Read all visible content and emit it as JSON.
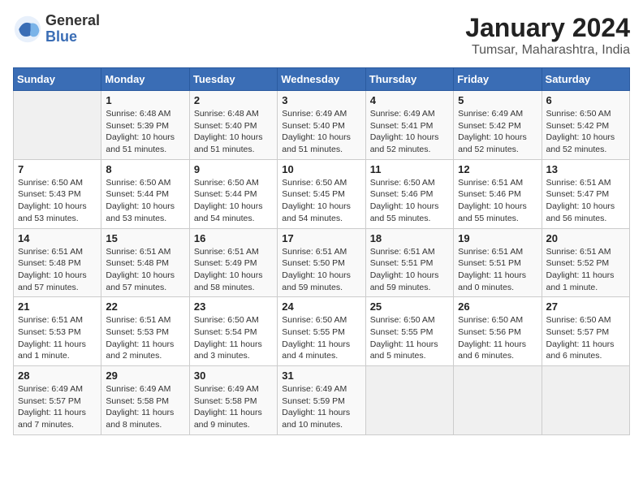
{
  "logo": {
    "general": "General",
    "blue": "Blue"
  },
  "title": {
    "month": "January 2024",
    "location": "Tumsar, Maharashtra, India"
  },
  "headers": [
    "Sunday",
    "Monday",
    "Tuesday",
    "Wednesday",
    "Thursday",
    "Friday",
    "Saturday"
  ],
  "weeks": [
    [
      {
        "day": "",
        "info": ""
      },
      {
        "day": "1",
        "info": "Sunrise: 6:48 AM\nSunset: 5:39 PM\nDaylight: 10 hours\nand 51 minutes."
      },
      {
        "day": "2",
        "info": "Sunrise: 6:48 AM\nSunset: 5:40 PM\nDaylight: 10 hours\nand 51 minutes."
      },
      {
        "day": "3",
        "info": "Sunrise: 6:49 AM\nSunset: 5:40 PM\nDaylight: 10 hours\nand 51 minutes."
      },
      {
        "day": "4",
        "info": "Sunrise: 6:49 AM\nSunset: 5:41 PM\nDaylight: 10 hours\nand 52 minutes."
      },
      {
        "day": "5",
        "info": "Sunrise: 6:49 AM\nSunset: 5:42 PM\nDaylight: 10 hours\nand 52 minutes."
      },
      {
        "day": "6",
        "info": "Sunrise: 6:50 AM\nSunset: 5:42 PM\nDaylight: 10 hours\nand 52 minutes."
      }
    ],
    [
      {
        "day": "7",
        "info": "Sunrise: 6:50 AM\nSunset: 5:43 PM\nDaylight: 10 hours\nand 53 minutes."
      },
      {
        "day": "8",
        "info": "Sunrise: 6:50 AM\nSunset: 5:44 PM\nDaylight: 10 hours\nand 53 minutes."
      },
      {
        "day": "9",
        "info": "Sunrise: 6:50 AM\nSunset: 5:44 PM\nDaylight: 10 hours\nand 54 minutes."
      },
      {
        "day": "10",
        "info": "Sunrise: 6:50 AM\nSunset: 5:45 PM\nDaylight: 10 hours\nand 54 minutes."
      },
      {
        "day": "11",
        "info": "Sunrise: 6:50 AM\nSunset: 5:46 PM\nDaylight: 10 hours\nand 55 minutes."
      },
      {
        "day": "12",
        "info": "Sunrise: 6:51 AM\nSunset: 5:46 PM\nDaylight: 10 hours\nand 55 minutes."
      },
      {
        "day": "13",
        "info": "Sunrise: 6:51 AM\nSunset: 5:47 PM\nDaylight: 10 hours\nand 56 minutes."
      }
    ],
    [
      {
        "day": "14",
        "info": "Sunrise: 6:51 AM\nSunset: 5:48 PM\nDaylight: 10 hours\nand 57 minutes."
      },
      {
        "day": "15",
        "info": "Sunrise: 6:51 AM\nSunset: 5:48 PM\nDaylight: 10 hours\nand 57 minutes."
      },
      {
        "day": "16",
        "info": "Sunrise: 6:51 AM\nSunset: 5:49 PM\nDaylight: 10 hours\nand 58 minutes."
      },
      {
        "day": "17",
        "info": "Sunrise: 6:51 AM\nSunset: 5:50 PM\nDaylight: 10 hours\nand 59 minutes."
      },
      {
        "day": "18",
        "info": "Sunrise: 6:51 AM\nSunset: 5:51 PM\nDaylight: 10 hours\nand 59 minutes."
      },
      {
        "day": "19",
        "info": "Sunrise: 6:51 AM\nSunset: 5:51 PM\nDaylight: 11 hours\nand 0 minutes."
      },
      {
        "day": "20",
        "info": "Sunrise: 6:51 AM\nSunset: 5:52 PM\nDaylight: 11 hours\nand 1 minute."
      }
    ],
    [
      {
        "day": "21",
        "info": "Sunrise: 6:51 AM\nSunset: 5:53 PM\nDaylight: 11 hours\nand 1 minute."
      },
      {
        "day": "22",
        "info": "Sunrise: 6:51 AM\nSunset: 5:53 PM\nDaylight: 11 hours\nand 2 minutes."
      },
      {
        "day": "23",
        "info": "Sunrise: 6:50 AM\nSunset: 5:54 PM\nDaylight: 11 hours\nand 3 minutes."
      },
      {
        "day": "24",
        "info": "Sunrise: 6:50 AM\nSunset: 5:55 PM\nDaylight: 11 hours\nand 4 minutes."
      },
      {
        "day": "25",
        "info": "Sunrise: 6:50 AM\nSunset: 5:55 PM\nDaylight: 11 hours\nand 5 minutes."
      },
      {
        "day": "26",
        "info": "Sunrise: 6:50 AM\nSunset: 5:56 PM\nDaylight: 11 hours\nand 6 minutes."
      },
      {
        "day": "27",
        "info": "Sunrise: 6:50 AM\nSunset: 5:57 PM\nDaylight: 11 hours\nand 6 minutes."
      }
    ],
    [
      {
        "day": "28",
        "info": "Sunrise: 6:49 AM\nSunset: 5:57 PM\nDaylight: 11 hours\nand 7 minutes."
      },
      {
        "day": "29",
        "info": "Sunrise: 6:49 AM\nSunset: 5:58 PM\nDaylight: 11 hours\nand 8 minutes."
      },
      {
        "day": "30",
        "info": "Sunrise: 6:49 AM\nSunset: 5:58 PM\nDaylight: 11 hours\nand 9 minutes."
      },
      {
        "day": "31",
        "info": "Sunrise: 6:49 AM\nSunset: 5:59 PM\nDaylight: 11 hours\nand 10 minutes."
      },
      {
        "day": "",
        "info": ""
      },
      {
        "day": "",
        "info": ""
      },
      {
        "day": "",
        "info": ""
      }
    ]
  ]
}
